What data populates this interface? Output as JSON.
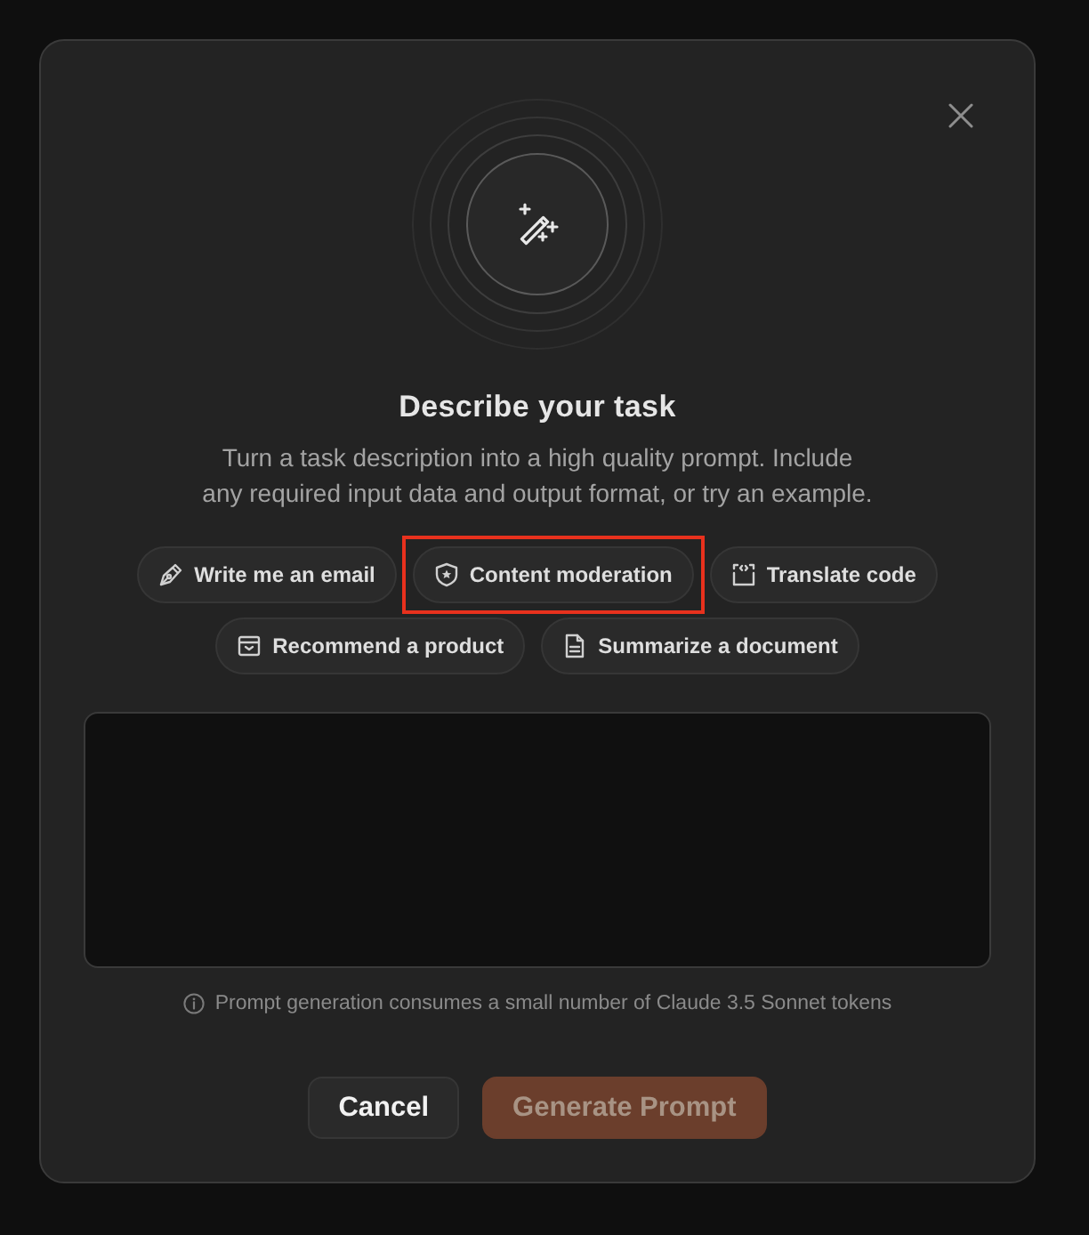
{
  "dialog": {
    "title": "Describe your task",
    "description": "Turn a task description into a high quality prompt. Include any required input data and output format, or try an example.",
    "examples": [
      {
        "label": "Write me an email",
        "kind": "pen",
        "highlighted": false
      },
      {
        "label": "Content moderation",
        "kind": "shield",
        "highlighted": true
      },
      {
        "label": "Translate code",
        "kind": "code",
        "highlighted": false
      },
      {
        "label": "Recommend a product",
        "kind": "tray",
        "highlighted": false
      },
      {
        "label": "Summarize a document",
        "kind": "document",
        "highlighted": false
      }
    ],
    "note": "Prompt generation consumes a small number of Claude 3.5 Sonnet tokens",
    "buttons": [
      {
        "label": "Cancel",
        "kind": "secondary",
        "disabled": false
      },
      {
        "label": "Generate Prompt",
        "kind": "primary",
        "disabled": true
      }
    ]
  }
}
